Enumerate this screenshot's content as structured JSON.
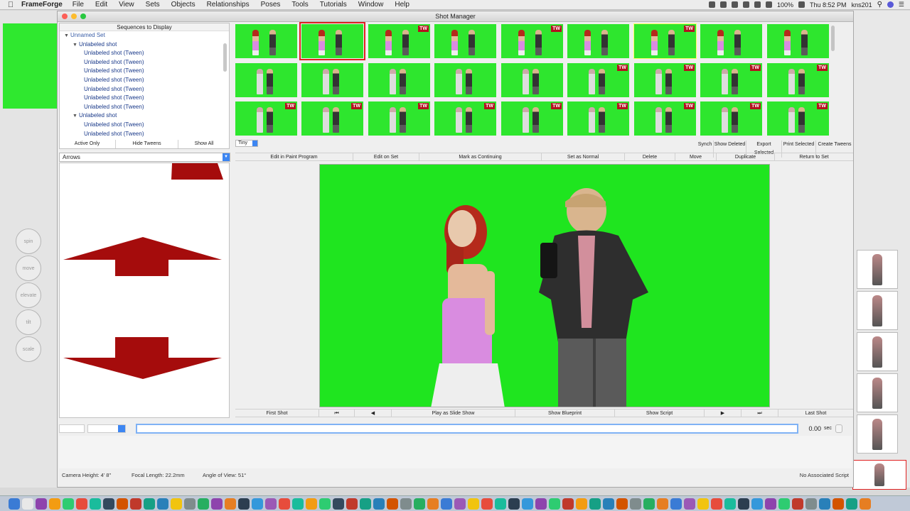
{
  "menubar": {
    "app_name": "FrameForge",
    "items": [
      "File",
      "Edit",
      "View",
      "Sets",
      "Objects",
      "Relationships",
      "Poses",
      "Tools",
      "Tutorials",
      "Window",
      "Help"
    ],
    "battery": "100%",
    "clock": "Thu 8:52 PM",
    "user": "kns201"
  },
  "window": {
    "title": "Shot Manager"
  },
  "sequences": {
    "header": "Sequences to Display",
    "rows": [
      {
        "level": 0,
        "expanded": true,
        "label": "Unnamed Set"
      },
      {
        "level": 1,
        "expanded": true,
        "label": "Unlabeled shot"
      },
      {
        "level": 2,
        "label": "Unlabeled shot (Tween)"
      },
      {
        "level": 2,
        "label": "Unlabeled shot (Tween)"
      },
      {
        "level": 2,
        "label": "Unlabeled shot (Tween)"
      },
      {
        "level": 2,
        "label": "Unlabeled shot (Tween)"
      },
      {
        "level": 2,
        "label": "Unlabeled shot (Tween)"
      },
      {
        "level": 2,
        "label": "Unlabeled shot (Tween)"
      },
      {
        "level": 2,
        "label": "Unlabeled shot (Tween)"
      },
      {
        "level": 1,
        "expanded": true,
        "label": "Unlabeled shot"
      },
      {
        "level": 2,
        "label": "Unlabeled shot (Tween)"
      },
      {
        "level": 2,
        "label": "Unlabeled shot (Tween)"
      }
    ],
    "buttons": [
      "Active Only",
      "Hide Tweens",
      "Show All"
    ]
  },
  "arrows": {
    "select_value": "Arrows",
    "shape_color": "#a50c0c"
  },
  "thumbnails": {
    "size_value": "Tiny",
    "tw_label": "TW",
    "rows": [
      [
        false,
        false,
        true,
        false,
        true,
        false,
        true,
        false,
        false
      ],
      [
        false,
        false,
        false,
        false,
        false,
        true,
        true,
        true,
        true
      ],
      [
        true,
        true,
        true,
        true,
        true,
        true,
        true,
        true,
        true
      ]
    ],
    "selected_index": 1,
    "highlight_index": 6,
    "actions": [
      "Synch",
      "Show Deleted",
      "Export Selected",
      "Print Selected",
      "Create Tweens"
    ]
  },
  "toolbar": {
    "buttons": [
      "Edit in Paint Program",
      "Edit on Set",
      "Mark as Continuing",
      "Set as Normal",
      "Delete",
      "Move",
      "Duplicate",
      "Return to Set"
    ]
  },
  "preview": {
    "background_color": "#1fe51f"
  },
  "navigation": {
    "first": "First Shot",
    "first_icon": "⏮",
    "prev_icon": "◀",
    "slideshow": "Play as Slide Show",
    "blueprint": "Show Blueprint",
    "script": "Show Script",
    "next_icon": "▶",
    "last_icon": "⏭",
    "last": "Last Shot"
  },
  "script": {
    "input_value": "",
    "time": "0.00",
    "time_unit": "sec"
  },
  "status": {
    "camera_height": "Camera Height: 4' 8\"",
    "focal_length": "Focal Length: 22.2mm",
    "angle_of_view": "Angle of View: 51°",
    "associated_script": "No Associated Script"
  },
  "dials": [
    "spin",
    "move",
    "elevate",
    "tilt",
    "scale"
  ],
  "colors": {
    "green_screen": "#2ee62e",
    "tw_badge": "#b3121f",
    "selection": "#e02020",
    "accent_blue": "#3d86f2"
  }
}
